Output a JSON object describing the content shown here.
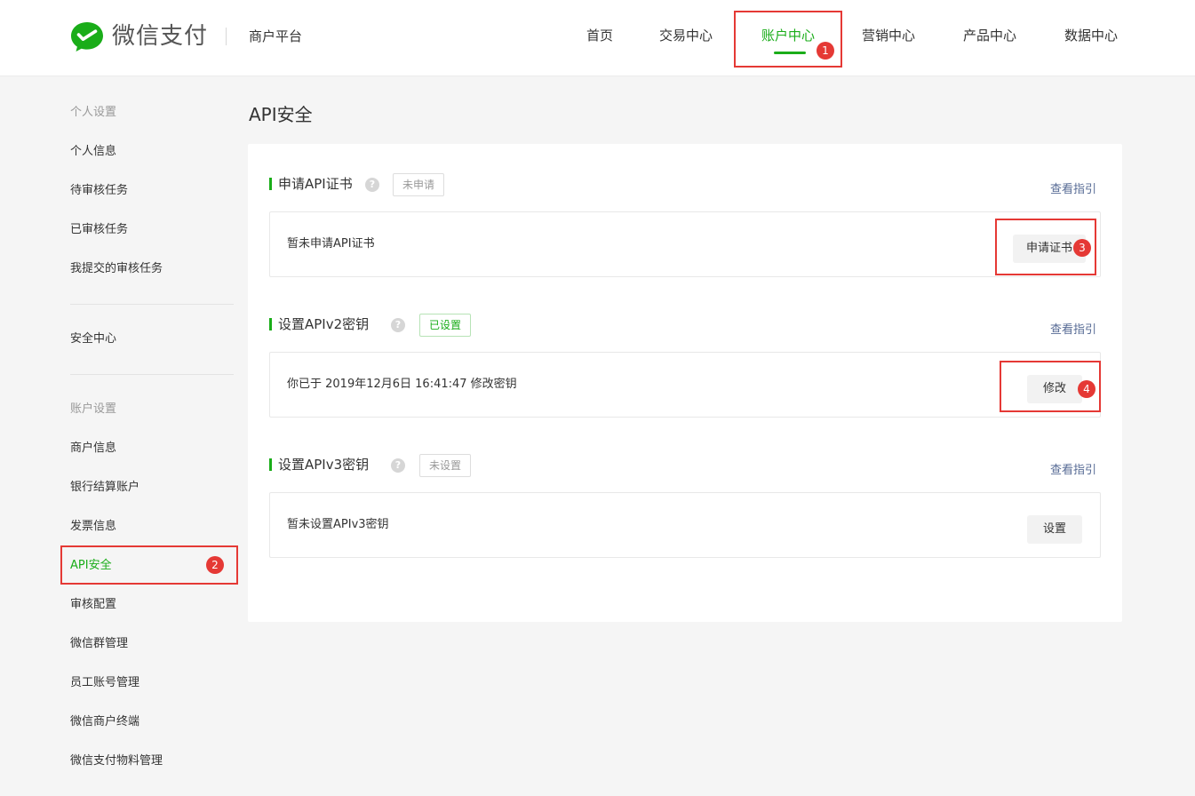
{
  "header": {
    "logo_text": "微信支付",
    "platform": "商户平台",
    "nav": [
      {
        "label": "首页"
      },
      {
        "label": "交易中心"
      },
      {
        "label": "账户中心",
        "active": true
      },
      {
        "label": "营销中心"
      },
      {
        "label": "产品中心"
      },
      {
        "label": "数据中心"
      }
    ]
  },
  "annotations": [
    "1",
    "2",
    "3",
    "4"
  ],
  "sidebar": {
    "group1": "个人设置",
    "items1": [
      "个人信息",
      "待审核任务",
      "已审核任务",
      "我提交的审核任务"
    ],
    "security": "安全中心",
    "group2": "账户设置",
    "items2": [
      "商户信息",
      "银行结算账户",
      "发票信息",
      "API安全",
      "审核配置",
      "微信群管理",
      "员工账号管理",
      "微信商户终端",
      "微信支付物料管理"
    ]
  },
  "main": {
    "title": "API安全",
    "sections": [
      {
        "title": "申请API证书",
        "help": "?",
        "tag": "未申请",
        "guide": "查看指引",
        "text": "暂未申请API证书",
        "button": "申请证书"
      },
      {
        "title": "设置APIv2密钥",
        "help": "?",
        "tag": "已设置",
        "guide": "查看指引",
        "text": "你已于 2019年12月6日 16:41:47 修改密钥",
        "button": "修改"
      },
      {
        "title": "设置APIv3密钥",
        "help": "?",
        "tag": "未设置",
        "guide": "查看指引",
        "text": "暂未设置APIv3密钥",
        "button": "设置"
      }
    ]
  },
  "colors": {
    "accent": "#1aad19",
    "annotation": "#e53935",
    "link": "#576b95"
  }
}
